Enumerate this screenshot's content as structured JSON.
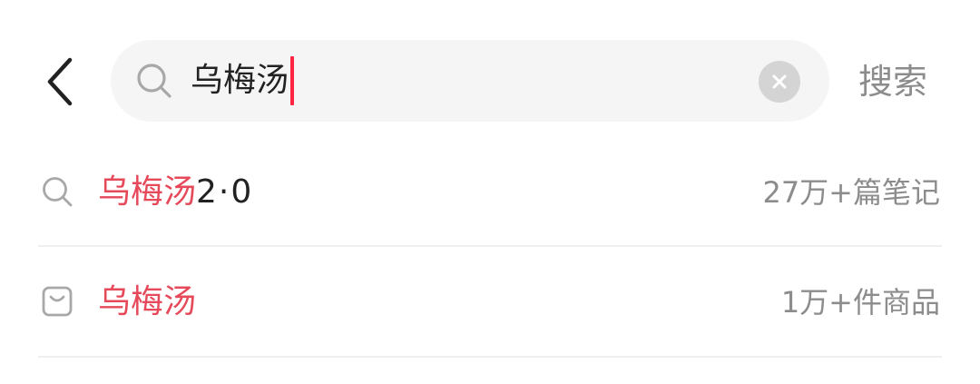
{
  "header": {
    "search_query": "乌梅汤",
    "submit_label": "搜索"
  },
  "suggestions": [
    {
      "highlight": "乌梅汤",
      "rest": "2·0",
      "meta": "27万+篇笔记",
      "icon": "search-icon"
    },
    {
      "highlight": "乌梅汤",
      "rest": "",
      "meta": "1万+件商品",
      "icon": "shopping-bag-icon"
    }
  ],
  "colors": {
    "accent": "#ff2442",
    "highlight_text": "#e64a5a",
    "secondary_text": "#8c8c8c",
    "search_bg": "#f5f5f5"
  }
}
